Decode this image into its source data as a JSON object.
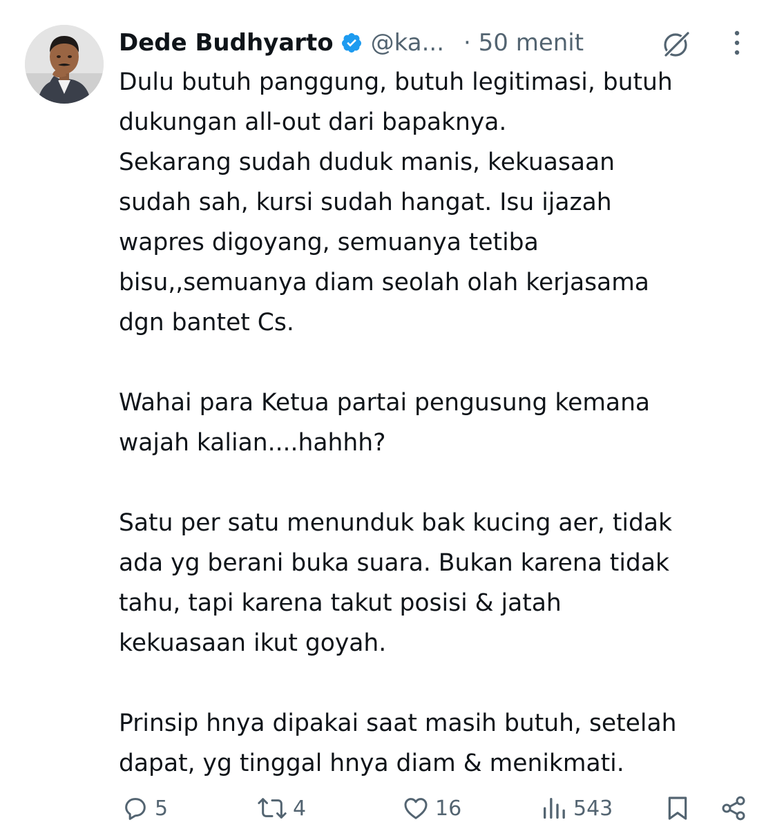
{
  "author": {
    "display_name": "Dede Budhyarto",
    "handle": "@ka...",
    "time": "· 50 menit",
    "verified_color": "#1d9bf0",
    "avatar": "profile-photo"
  },
  "tweet": {
    "paragraphs": [
      "Dulu butuh panggung, butuh legitimasi, butuh\ndukungan all-out dari bapaknya.\nSekarang sudah duduk manis, kekuasaan\nsudah sah, kursi sudah hangat. Isu ijazah\nwapres digoyang, semuanya tetiba\nbisu,,semuanya diam seolah olah kerjasama\ndgn bantet Cs.",
      "Wahai para Ketua partai pengusung kemana\nwajah kalian....hahhh?",
      "Satu per satu menunduk bak kucing aer, tidak\nada yg berani buka suara. Bukan karena tidak\ntahu, tapi karena takut posisi & jatah\nkekuasaan ikut goyah.",
      "Prinsip hnya dipakai saat masih butuh, setelah\ndapat, yg tinggal hnya diam & menikmati."
    ]
  },
  "actions": {
    "replies": "5",
    "retweets": "4",
    "likes": "16",
    "views": "543"
  },
  "icons": {
    "header": [
      "verified-badge-icon",
      "grok-icon",
      "more-icon"
    ],
    "actions": [
      "reply-icon",
      "retweet-icon",
      "like-icon",
      "views-icon",
      "bookmark-icon",
      "share-icon"
    ]
  }
}
